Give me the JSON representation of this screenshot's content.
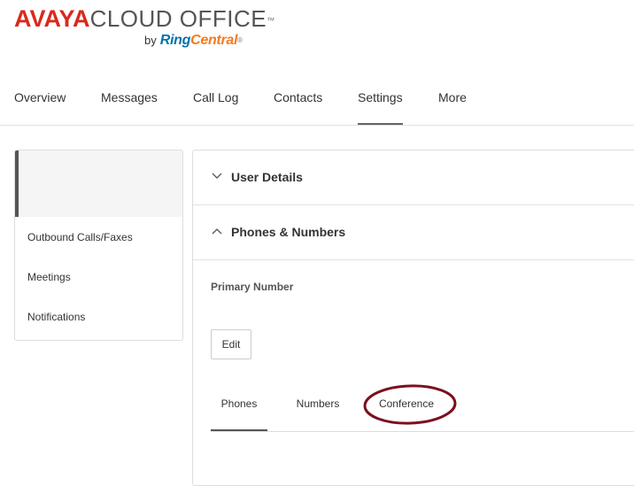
{
  "logo": {
    "brand": "AVAYA",
    "product": "CLOUD OFFICE",
    "tm": "™",
    "by": "by",
    "partner_part1": "Ring",
    "partner_part2": "Central",
    "partner_mark": "®"
  },
  "topnav": {
    "items": [
      {
        "label": "Overview"
      },
      {
        "label": "Messages"
      },
      {
        "label": "Call Log"
      },
      {
        "label": "Contacts"
      },
      {
        "label": "Settings",
        "active": true
      },
      {
        "label": "More"
      }
    ]
  },
  "sidebar": {
    "items": [
      {
        "label": "Outbound Calls/Faxes"
      },
      {
        "label": "Meetings"
      },
      {
        "label": "Notifications"
      }
    ]
  },
  "main": {
    "sections": [
      {
        "title": "User Details",
        "expanded": false,
        "chevron": "chevron-down-icon"
      },
      {
        "title": "Phones & Numbers",
        "expanded": true,
        "chevron": "chevron-up-icon"
      }
    ],
    "primary_number_label": "Primary Number",
    "edit_label": "Edit",
    "tabs": [
      {
        "label": "Phones",
        "active": true
      },
      {
        "label": "Numbers"
      },
      {
        "label": "Conference",
        "highlighted": true
      }
    ]
  },
  "colors": {
    "brand_red": "#da291c",
    "partner_blue": "#0073ae",
    "partner_orange": "#f47a21",
    "annotation": "#7a1020"
  }
}
